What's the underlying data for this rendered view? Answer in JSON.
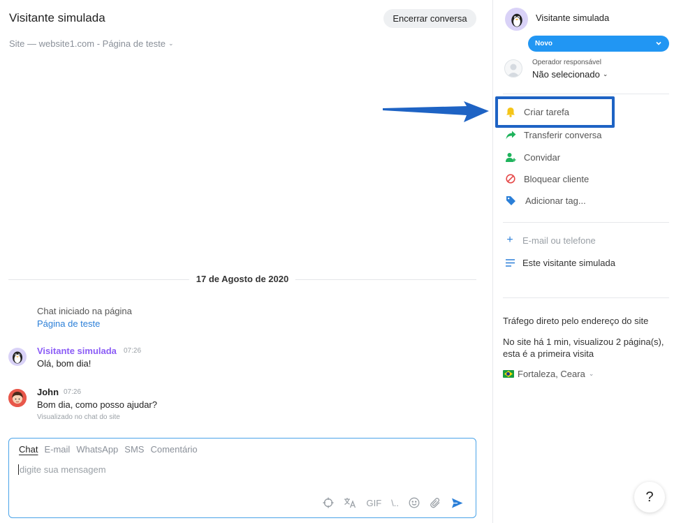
{
  "conversation": {
    "title": "Visitante simulada",
    "end_button": "Encerrar conversa",
    "site_line": "Site — website1.com - Página de teste"
  },
  "chat": {
    "date": "17 de Agosto de 2020",
    "system_message": "Chat iniciado na página",
    "system_link": "Página de teste",
    "messages": [
      {
        "author": "Visitante simulada",
        "time": "07:26",
        "text": "Olá, bom dia!",
        "avatar": "penguin-avatar"
      },
      {
        "author": "John",
        "time": "07:26",
        "text": "Bom dia, como posso ajudar?",
        "note": "Visualizado no chat do site",
        "avatar": "operator-avatar"
      }
    ]
  },
  "composer": {
    "tabs": [
      "Chat",
      "E-mail",
      "WhatsApp",
      "SMS",
      "Comentário"
    ],
    "active_tab": "Chat",
    "placeholder": "digite sua mensagem",
    "gif_label": "GIF",
    "shortcut_label": "\\.."
  },
  "panel": {
    "visitor_name": "Visitante simulada",
    "status": "Novo",
    "operator_label": "Operador responsável",
    "operator_value": "Não selecionado",
    "actions": [
      {
        "label": "Criar tarefa",
        "icon": "bell-icon",
        "color": "#f5c518"
      },
      {
        "label": "Transferir conversa",
        "icon": "share-arrow-icon",
        "color": "#1fb35c"
      },
      {
        "label": "Convidar",
        "icon": "add-user-icon",
        "color": "#1fb35c"
      },
      {
        "label": "Bloquear cliente",
        "icon": "block-icon",
        "color": "#e54848"
      },
      {
        "label": "Adicionar tag...",
        "icon": "tag-icon",
        "color": "#2b7fd8"
      }
    ],
    "contact_placeholder": "E-mail ou telefone",
    "visitor_note": "Este visitante simulada",
    "traffic": "Tráfego direto pelo endereço do site",
    "visit_info": "No site há 1 min, visualizou 2 página(s), esta é a primeira visita",
    "location": "Fortaleza, Ceara"
  },
  "help_label": "?",
  "colors": {
    "accent": "#2196f3",
    "highlight": "#1e63c4",
    "visitor_name": "#8b5cf6",
    "link": "#2b7fd8"
  }
}
